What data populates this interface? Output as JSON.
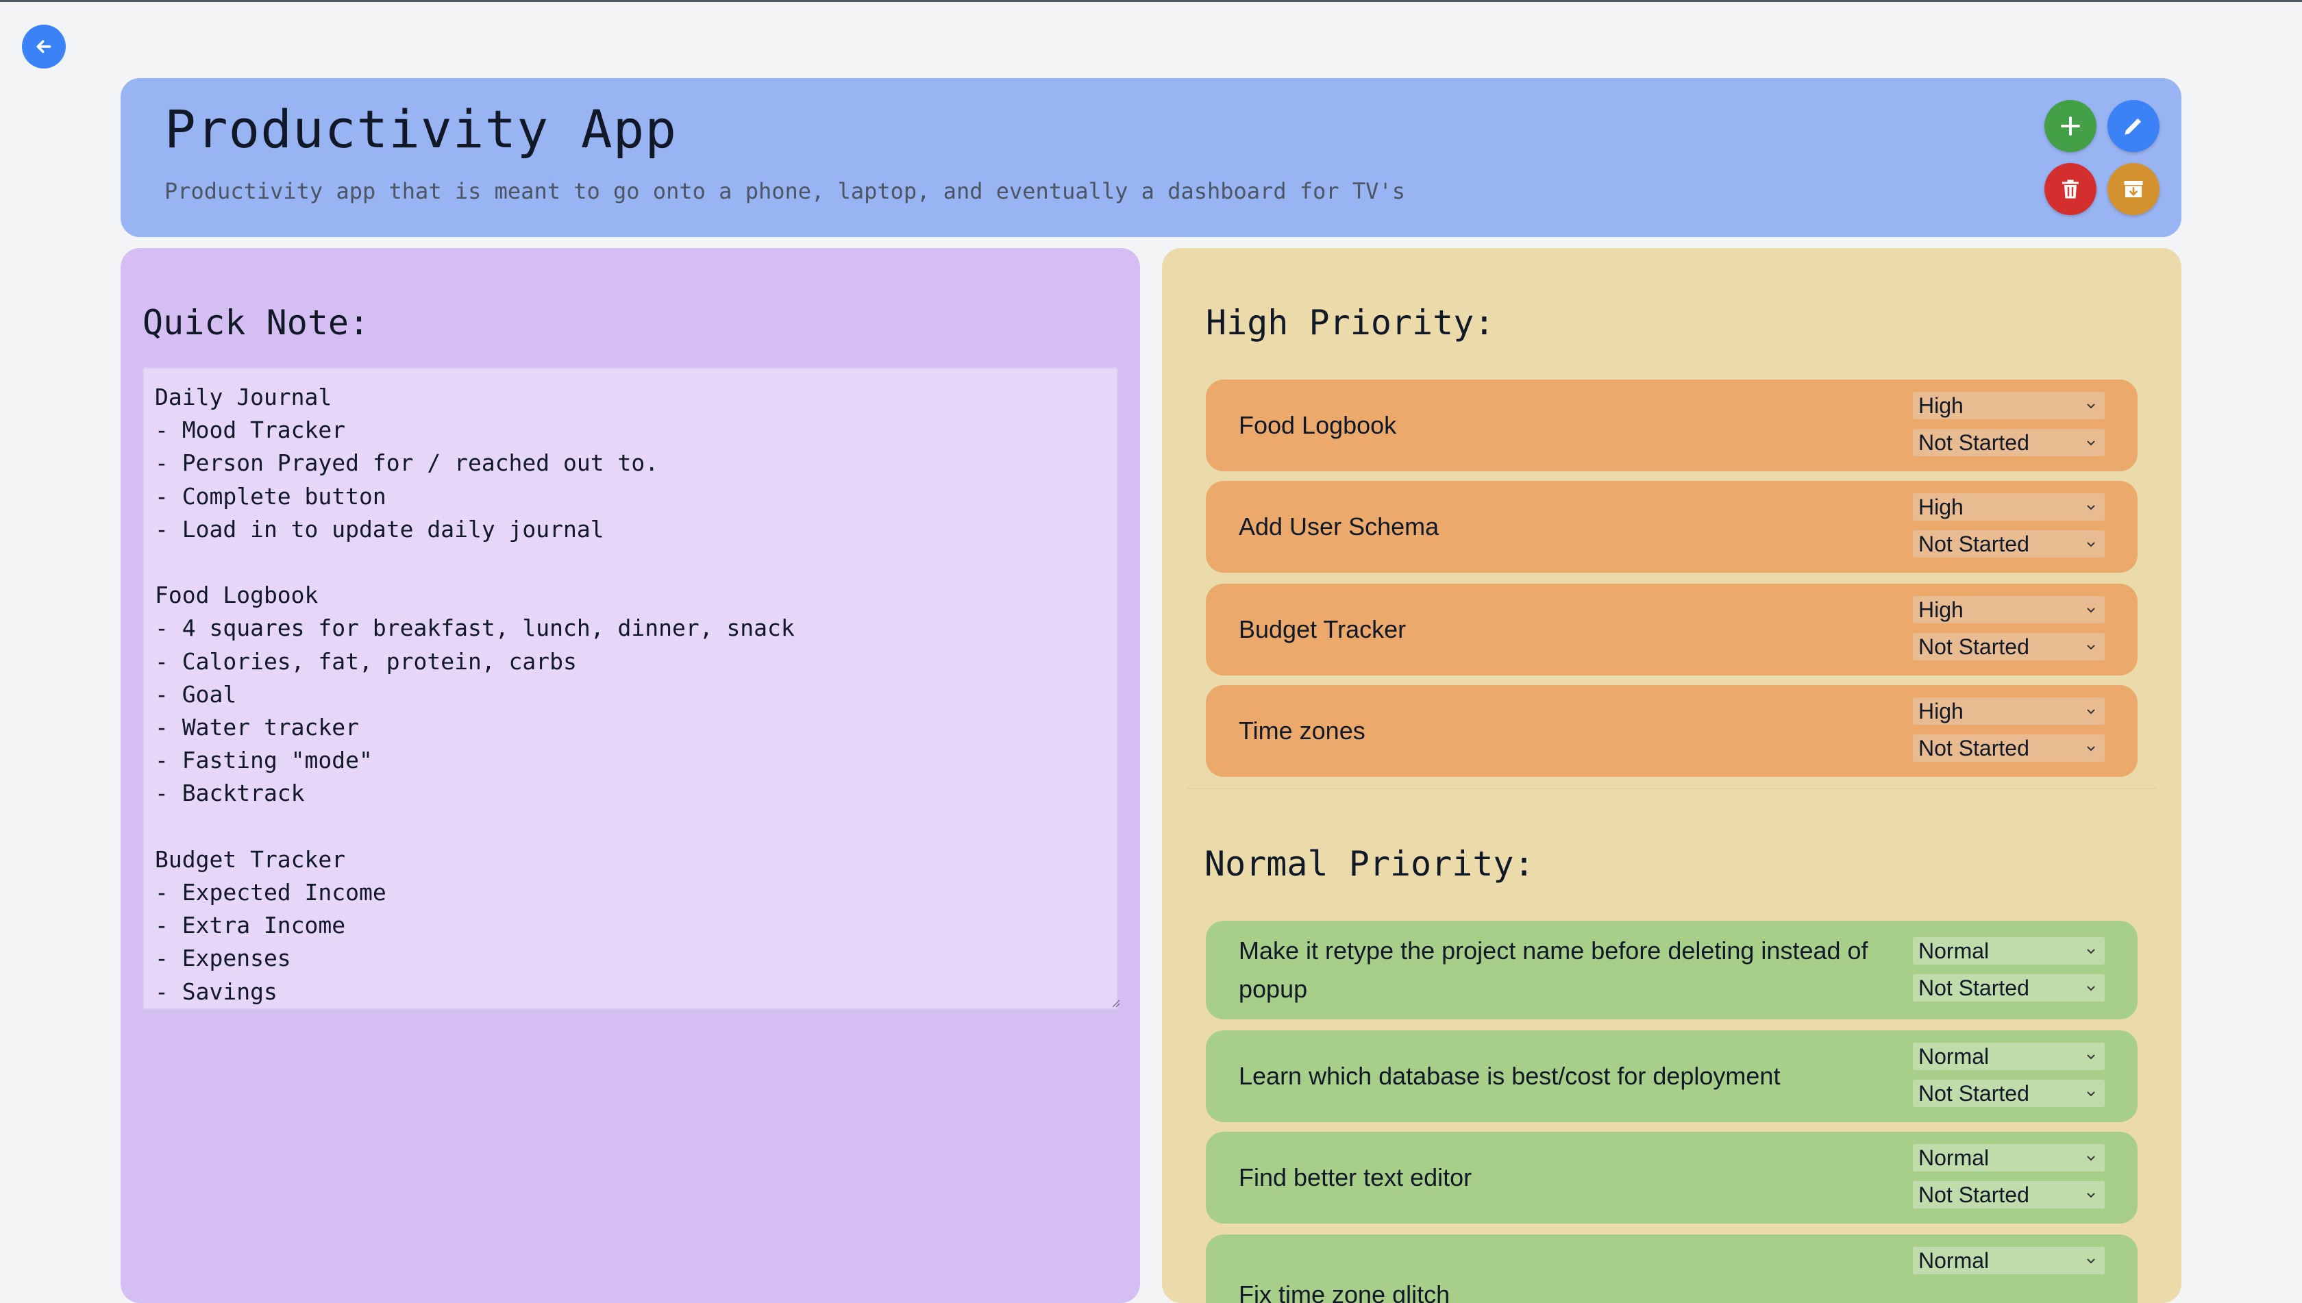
{
  "header": {
    "title": "Productivity App",
    "description": "Productivity app that is meant to go onto a phone, laptop, and eventually a dashboard for TV's"
  },
  "actions": {
    "add": "plus-icon",
    "edit": "pencil-icon",
    "delete": "trash-icon",
    "archive": "archive-icon"
  },
  "colors": {
    "header_bg": "#99b4f2",
    "note_panel_bg": "#d5bff2",
    "task_panel_bg": "#ecdbaa",
    "high_task_bg": "#eba96c",
    "normal_task_bg": "#a7cf8a",
    "add_button": "#43a047",
    "edit_button": "#3b82f6",
    "delete_button": "#d32f2f",
    "archive_button": "#d4922f"
  },
  "quick_note": {
    "heading": "Quick Note:",
    "content": "Daily Journal\n- Mood Tracker\n- Person Prayed for / reached out to.\n- Complete button\n- Load in to update daily journal\n\nFood Logbook\n- 4 squares for breakfast, lunch, dinner, snack\n- Calories, fat, protein, carbs\n- Goal\n- Water tracker\n- Fasting \"mode\"\n- Backtrack\n\nBudget Tracker\n- Expected Income\n- Extra Income\n- Expenses\n- Savings"
  },
  "high_priority": {
    "heading": "High Priority:",
    "tasks": [
      {
        "title": "Food Logbook",
        "priority": "High",
        "status": "Not Started"
      },
      {
        "title": "Add User Schema",
        "priority": "High",
        "status": "Not Started"
      },
      {
        "title": "Budget Tracker",
        "priority": "High",
        "status": "Not Started"
      },
      {
        "title": "Time zones",
        "priority": "High",
        "status": "Not Started"
      }
    ]
  },
  "normal_priority": {
    "heading": "Normal Priority:",
    "tasks": [
      {
        "title": "Make it retype the project name before deleting instead of popup",
        "priority": "Normal",
        "status": "Not Started"
      },
      {
        "title": "Learn which database is best/cost for deployment",
        "priority": "Normal",
        "status": "Not Started"
      },
      {
        "title": "Find better text editor",
        "priority": "Normal",
        "status": "Not Started"
      },
      {
        "title": "Fix time zone glitch",
        "priority": "Normal",
        "status": ""
      }
    ]
  }
}
